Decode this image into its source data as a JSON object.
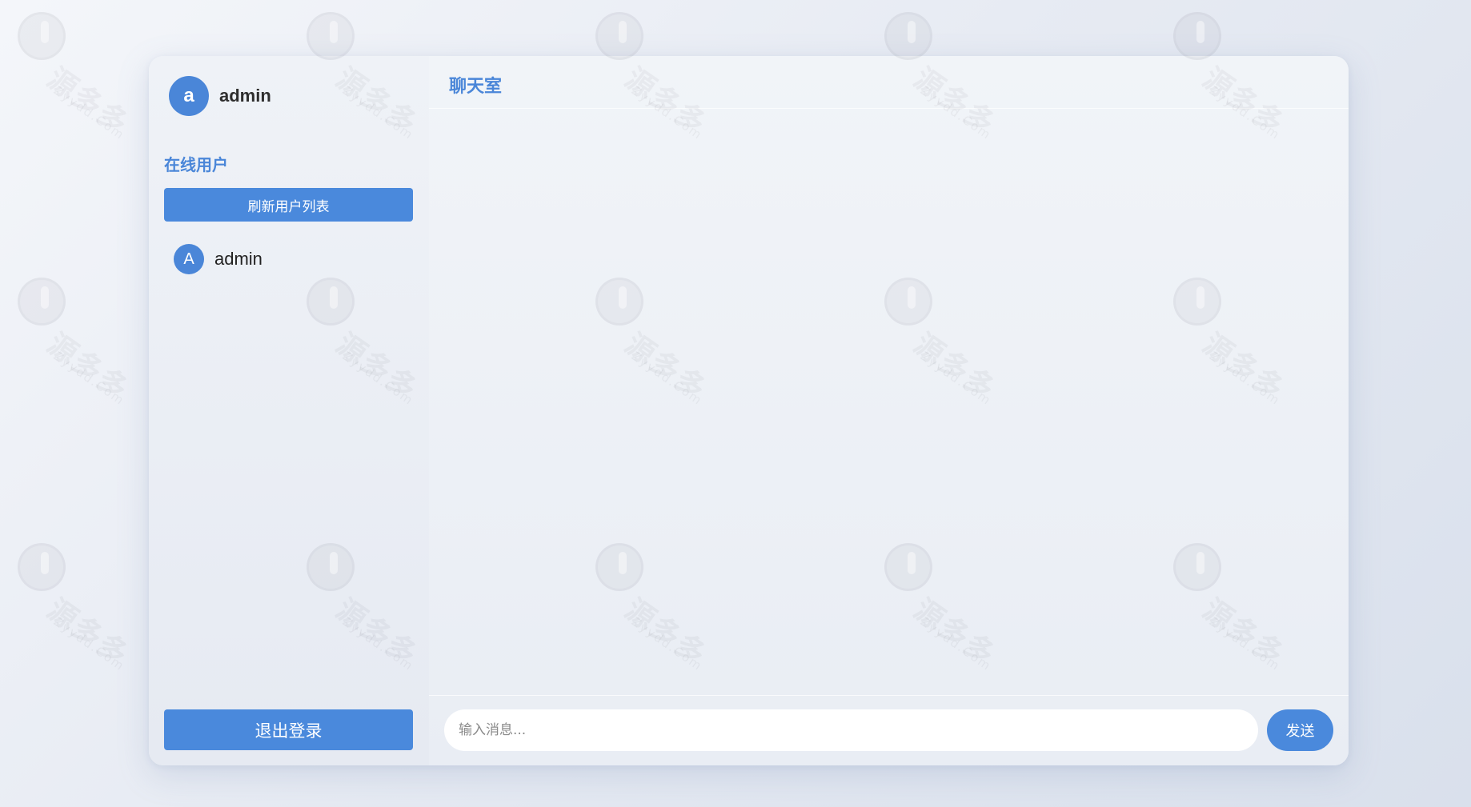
{
  "current_user": {
    "initial": "a",
    "name": "admin"
  },
  "sidebar": {
    "section_title": "在线用户",
    "refresh_label": "刷新用户列表",
    "users": [
      {
        "initial": "A",
        "name": "admin"
      }
    ],
    "logout_label": "退出登录"
  },
  "chat": {
    "title": "聊天室",
    "input_placeholder": "输入消息...",
    "send_label": "发送"
  },
  "watermark": {
    "text": "源多多",
    "sub": "Zyydd.Com"
  },
  "colors": {
    "accent": "#4a89dc",
    "background": "#e7ebf3"
  }
}
